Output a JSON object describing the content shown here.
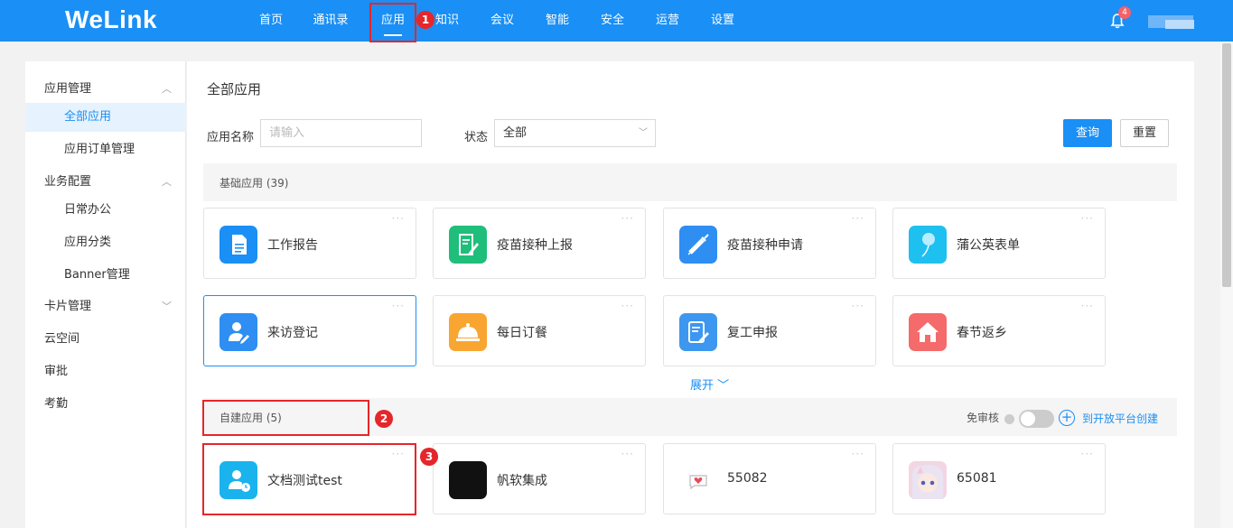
{
  "header": {
    "logo": "WeLink",
    "nav": [
      "首页",
      "通讯录",
      "应用",
      "知识",
      "会议",
      "智能",
      "安全",
      "运营",
      "设置"
    ],
    "active_nav": "应用",
    "notification_count": "4"
  },
  "sidebar": {
    "items": [
      {
        "label": "应用管理",
        "type": "group",
        "chevron": "up"
      },
      {
        "label": "全部应用",
        "type": "sub",
        "active": true
      },
      {
        "label": "应用订单管理",
        "type": "sub"
      },
      {
        "label": "业务配置",
        "type": "group",
        "chevron": "up"
      },
      {
        "label": "日常办公",
        "type": "sub"
      },
      {
        "label": "应用分类",
        "type": "sub"
      },
      {
        "label": "Banner管理",
        "type": "sub"
      },
      {
        "label": "卡片管理",
        "type": "group",
        "chevron": "down"
      },
      {
        "label": "云空间",
        "type": "group"
      },
      {
        "label": "审批",
        "type": "group"
      },
      {
        "label": "考勤",
        "type": "group"
      }
    ]
  },
  "main": {
    "title": "全部应用",
    "filters": {
      "name_label": "应用名称",
      "name_placeholder": "请输入",
      "status_label": "状态",
      "status_value": "全部"
    },
    "buttons": {
      "query": "查询",
      "reset": "重置"
    },
    "basic_section": "基础应用 (39)",
    "basic_apps": [
      {
        "name": "工作报告",
        "icon": "document-icon",
        "color": "#1a8ff5"
      },
      {
        "name": "疫苗接种上报",
        "icon": "pen-document-icon",
        "color": "#1fbe7a"
      },
      {
        "name": "疫苗接种申请",
        "icon": "syringe-icon",
        "color": "#2e8ef2"
      },
      {
        "name": "蒲公英表单",
        "icon": "dandelion-icon",
        "color": "#1ec0f0"
      },
      {
        "name": "来访登记",
        "icon": "visitor-icon",
        "color": "#2e8ef2"
      },
      {
        "name": "每日订餐",
        "icon": "dining-bell-icon",
        "color": "#f8a631"
      },
      {
        "name": "复工申报",
        "icon": "form-edit-icon",
        "color": "#3d97ef"
      },
      {
        "name": "春节返乡",
        "icon": "house-icon",
        "color": "#f56a6a"
      }
    ],
    "expand_label": "展开",
    "custom_section": "自建应用 (5)",
    "no_review_label": "免审核",
    "create_link": "到开放平台创建",
    "custom_apps": [
      {
        "name": "文档测试test",
        "icon": "user-clock-icon",
        "color": "#1ab3ee"
      },
      {
        "name": "帆软集成",
        "icon": "dark-logo-icon",
        "color": "#111111"
      },
      {
        "name": "55082",
        "icon": "heart-chat-icon",
        "color": "#ffffff"
      },
      {
        "name": "65081",
        "icon": "anime-avatar-icon",
        "color": "#f3d6e3"
      }
    ]
  },
  "annotations": [
    "1",
    "2",
    "3"
  ]
}
